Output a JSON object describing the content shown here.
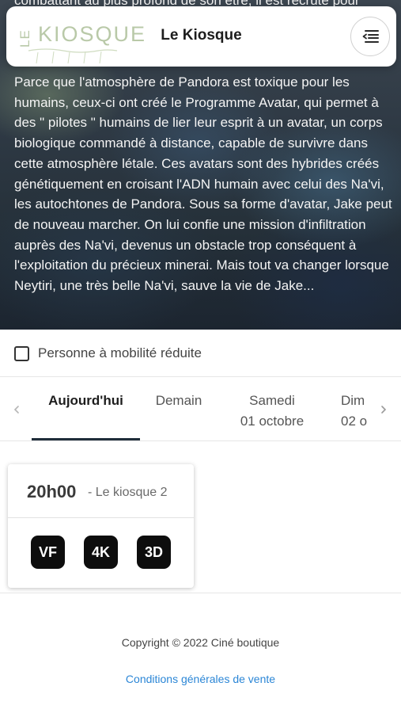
{
  "synopsis": {
    "top_partial": "combattant au plus profond de son être, il est recruté pour",
    "text": "Parce que l'atmosphère de Pandora est toxique pour les humains, ceux-ci ont créé le Programme Avatar, qui permet à des \" pilotes \" humains de lier leur esprit à un avatar, un corps biologique commandé à distance, capable de survivre dans cette atmosphère létale. Ces avatars sont des hybrides créés génétiquement en croisant l'ADN humain avec celui des Na'vi, les autochtones de Pandora. Sous sa forme d'avatar, Jake peut de nouveau marcher. On lui confie une mission d'infiltration auprès des Na'vi, devenus un obstacle trop conséquent à l'exploitation du précieux minerai. Mais tout va changer lorsque Neytiri, une très belle Na'vi, sauve la vie de Jake..."
  },
  "header": {
    "logo_prefix": "LE",
    "logo_word": "KIOSQUE",
    "title": "Le Kiosque",
    "menu_icon": "menu-list-icon"
  },
  "accessibility": {
    "label": "Personne à mobilité réduite",
    "checked": false
  },
  "tabs": [
    {
      "line1": "Aujourd'hui",
      "line2": "",
      "active": true
    },
    {
      "line1": "Demain",
      "line2": "",
      "active": false
    },
    {
      "line1": "Samedi",
      "line2": "01 octobre",
      "active": false
    },
    {
      "line1": "Dim",
      "line2": "02 o",
      "active": false
    }
  ],
  "showtime": {
    "time": "20h00",
    "room": " - Le kiosque 2",
    "badges": [
      "VF",
      "4K",
      "3D"
    ]
  },
  "footer": {
    "copyright": "Copyright © 2022 Ciné boutique",
    "cgv_link": "Conditions générales de vente"
  },
  "colors": {
    "link": "#2b86d6",
    "badge_bg": "#0d0d0d",
    "tab_indicator": "#1f2d3a",
    "logo": "#b9c9a8"
  }
}
